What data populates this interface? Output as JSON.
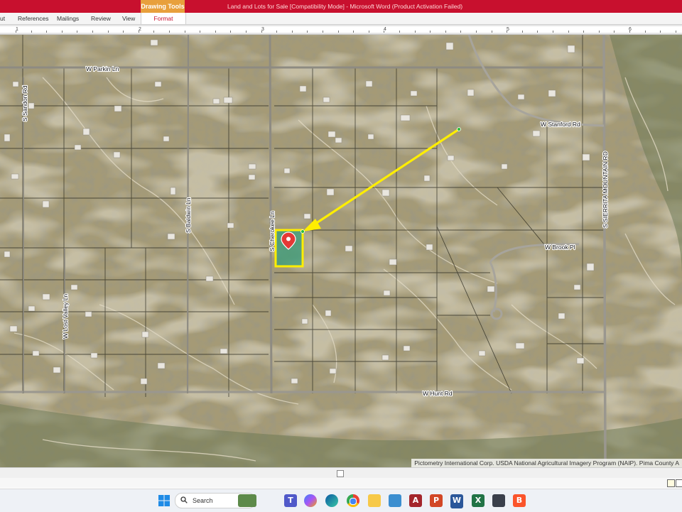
{
  "ribbon": {
    "context_tab": "Drawing Tools",
    "doc_title": "Land and Lots for Sale [Compatibility Mode]  -  Microsoft Word (Product Activation Failed)",
    "tabs": [
      "ut",
      "References",
      "Mailings",
      "Review",
      "View",
      "Format"
    ],
    "active_tab": "Format"
  },
  "ruler": {
    "numbers": [
      "1",
      "2",
      "3",
      "4",
      "5",
      "6"
    ]
  },
  "map": {
    "streets": {
      "parkin": "W Parkin Ln",
      "stanford": "W Stanford Rd",
      "brook": "W Brook Pl",
      "hunt": "W Hunt Rd",
      "sandon": "S Sandon Rd",
      "baldwin": "S Baldwin Ln",
      "cherokee": "S Cherokee Ln",
      "lost_valley": "W Lost Valley Ln",
      "sierrita": "S SIERRITA MOUNTAIN RD"
    },
    "attribution": "Pictometry International Corp. USDA National Agricultural Imagery Program (NAIP). Pima County A",
    "colors": {
      "arrow": "#ffee00",
      "parcel_outline": "#ffee00",
      "parcel_fill": "#3a9e7c",
      "pin": "#e53935"
    },
    "marker": "location-pin-icon"
  },
  "taskbar": {
    "search_placeholder": "Search",
    "apps": [
      "windows-start-icon",
      "search-icon",
      "widgets-icon",
      "teams-icon",
      "copilot-icon",
      "edge-icon",
      "chrome-icon",
      "file-explorer-icon",
      "photos-icon",
      "access-icon",
      "powerpoint-icon",
      "word-icon",
      "excel-icon",
      "vm-icon",
      "brave-icon"
    ]
  }
}
